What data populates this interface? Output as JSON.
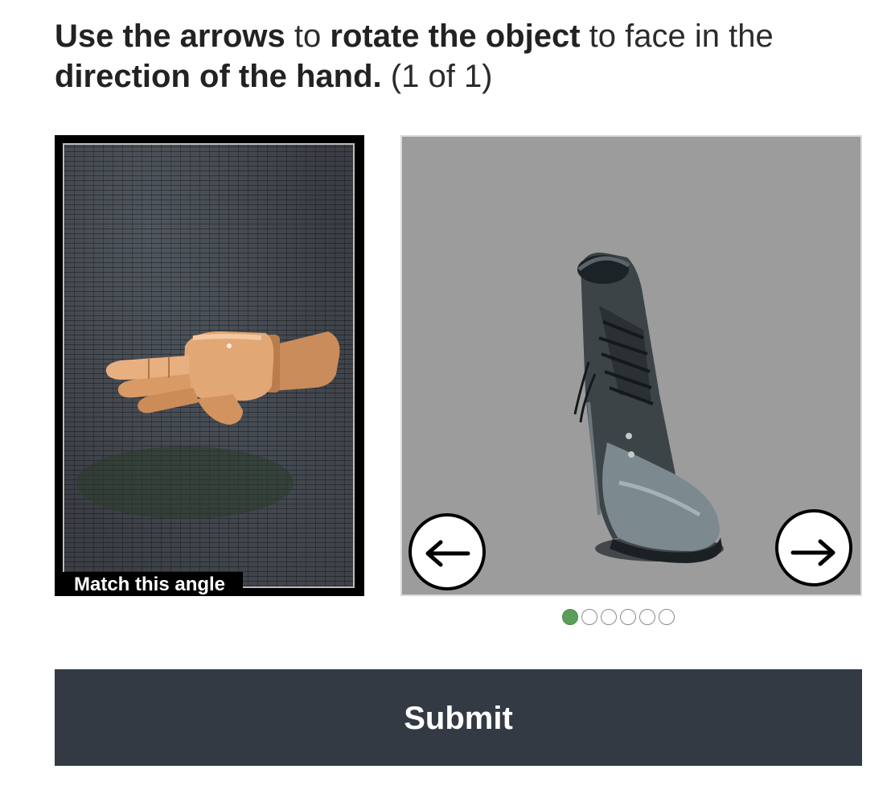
{
  "instructions": {
    "p1": "Use the arrows",
    "p2": " to ",
    "p3": "rotate the object",
    "p4": " to face in the ",
    "p5": "direction of the hand.",
    "p6": " (1 of 1)"
  },
  "reference": {
    "label": "Match this angle",
    "image": "wooden-pointing-hand"
  },
  "viewer": {
    "object": "boot",
    "left_arrow": "←",
    "right_arrow": "→",
    "dot_count": 6,
    "active_dot": 0
  },
  "submit": {
    "label": "Submit"
  },
  "colors": {
    "submit_bg": "#333a44",
    "active_dot": "#5a9e5a",
    "viewer_bg": "#9c9c9c"
  }
}
